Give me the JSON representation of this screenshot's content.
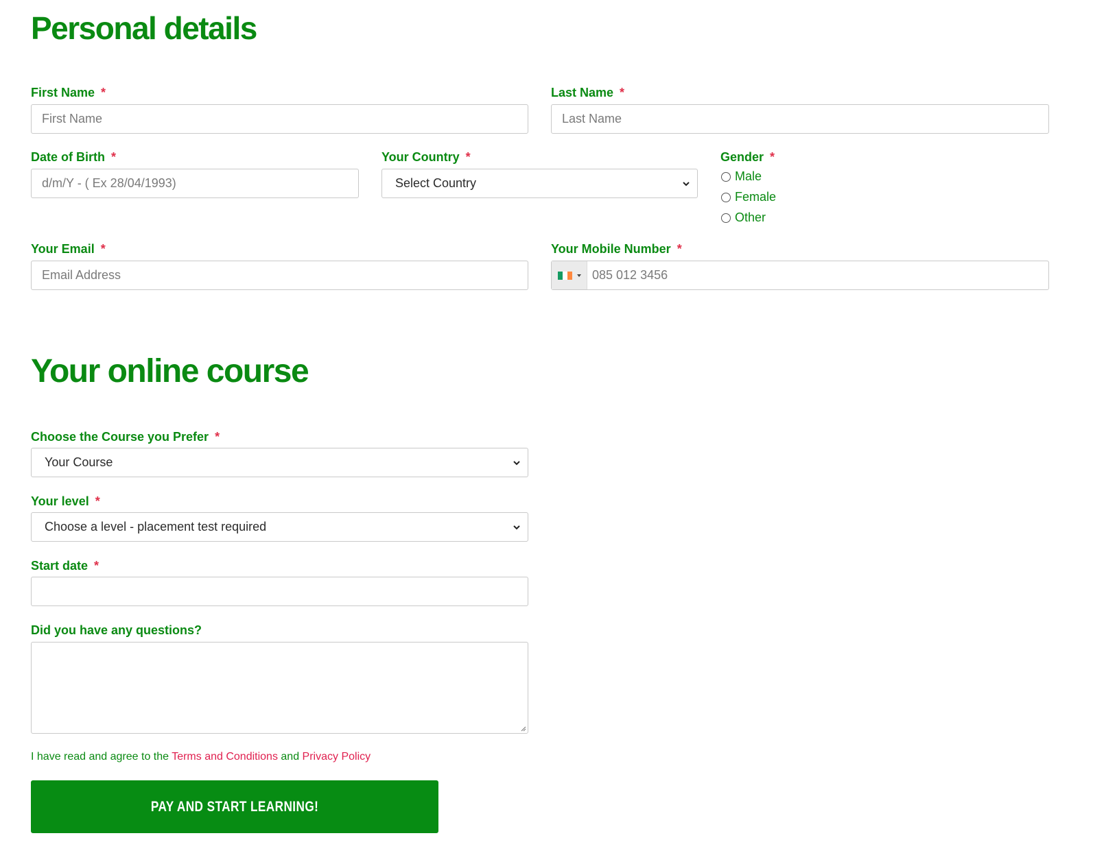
{
  "sections": {
    "personal_title": "Personal details",
    "course_title": "Your online course"
  },
  "fields": {
    "first_name": {
      "label": "First Name",
      "required": "*",
      "placeholder": "First Name"
    },
    "last_name": {
      "label": "Last Name",
      "required": "*",
      "placeholder": "Last Name"
    },
    "dob": {
      "label": "Date of Birth",
      "required": "*",
      "placeholder": "d/m/Y - ( Ex 28/04/1993)"
    },
    "country": {
      "label": "Your Country",
      "required": "*",
      "value": "Select Country"
    },
    "gender": {
      "label": "Gender",
      "required": "*",
      "options": [
        "Male",
        "Female",
        "Other"
      ]
    },
    "email": {
      "label": "Your Email",
      "required": "*",
      "placeholder": "Email Address"
    },
    "mobile": {
      "label": "Your Mobile Number",
      "required": "*",
      "placeholder": "085 012 3456",
      "flag_colors": [
        "#169b62",
        "#ffffff",
        "#ff883e"
      ]
    },
    "course": {
      "label": "Choose the Course you Prefer",
      "required": "*",
      "value": "Your Course"
    },
    "level": {
      "label": "Your level",
      "required": "*",
      "value": "Choose a level - placement test required"
    },
    "start_date": {
      "label": "Start date",
      "required": "*",
      "value": ""
    },
    "questions": {
      "label": "Did you have any questions?"
    }
  },
  "agreement": {
    "prefix": "I have read and agree to the ",
    "terms": "Terms and Conditions",
    "middle": " and ",
    "privacy": "Privacy Policy"
  },
  "submit": {
    "label": "PAY AND START LEARNING!"
  },
  "colors": {
    "accent": "#0a8a12",
    "required": "#e0314b",
    "link": "#e0204f",
    "button": "#078c13"
  }
}
